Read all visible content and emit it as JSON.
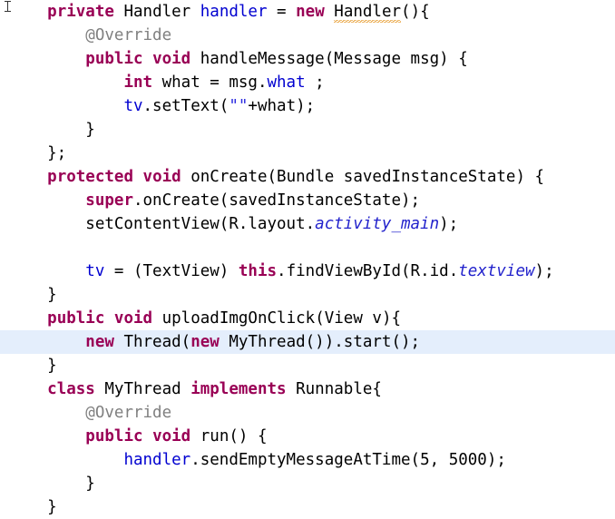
{
  "editor": {
    "language": "java",
    "background_color": "#ffffff",
    "highlight_color": "#e4eefc",
    "keyword_color": "#990055",
    "field_color": "#0000d0",
    "annotation_color": "#808080",
    "string_color": "#2a2ae0",
    "warning_squiggle_color": "#e8a33d",
    "cursor": "text-ibeam-cursor",
    "line_count": 20
  },
  "lines": [
    {
      "index": 0,
      "highlighted": false,
      "text": "    private Handler handler = new Handler(){",
      "tokens": [
        {
          "t": "    ",
          "c": "plain"
        },
        {
          "t": "private",
          "c": "kw"
        },
        {
          "t": " Handler ",
          "c": "plain"
        },
        {
          "t": "handler",
          "c": "field"
        },
        {
          "t": " = ",
          "c": "plain"
        },
        {
          "t": "new",
          "c": "kw"
        },
        {
          "t": " ",
          "c": "plain"
        },
        {
          "t": "Handler",
          "c": "warn"
        },
        {
          "t": "(){",
          "c": "plain"
        }
      ]
    },
    {
      "index": 1,
      "highlighted": false,
      "text": "        @Override",
      "tokens": [
        {
          "t": "        ",
          "c": "plain"
        },
        {
          "t": "@Override",
          "c": "anno"
        }
      ]
    },
    {
      "index": 2,
      "highlighted": false,
      "text": "        public void handleMessage(Message msg) {",
      "tokens": [
        {
          "t": "        ",
          "c": "plain"
        },
        {
          "t": "public",
          "c": "kw"
        },
        {
          "t": " ",
          "c": "plain"
        },
        {
          "t": "void",
          "c": "kw"
        },
        {
          "t": " handleMessage(Message msg) {",
          "c": "plain"
        }
      ]
    },
    {
      "index": 3,
      "highlighted": false,
      "text": "            int what = msg.what ;",
      "tokens": [
        {
          "t": "            ",
          "c": "plain"
        },
        {
          "t": "int",
          "c": "kw"
        },
        {
          "t": " what = msg.",
          "c": "plain"
        },
        {
          "t": "what",
          "c": "field"
        },
        {
          "t": " ;",
          "c": "plain"
        }
      ]
    },
    {
      "index": 4,
      "highlighted": false,
      "text": "            tv.setText(\"\"+what);",
      "tokens": [
        {
          "t": "            ",
          "c": "plain"
        },
        {
          "t": "tv",
          "c": "field"
        },
        {
          "t": ".setText(",
          "c": "plain"
        },
        {
          "t": "\"\"",
          "c": "str"
        },
        {
          "t": "+what);",
          "c": "plain"
        }
      ]
    },
    {
      "index": 5,
      "highlighted": false,
      "text": "        }",
      "tokens": [
        {
          "t": "        }",
          "c": "plain"
        }
      ]
    },
    {
      "index": 6,
      "highlighted": false,
      "text": "    };",
      "tokens": [
        {
          "t": "    };",
          "c": "plain"
        }
      ]
    },
    {
      "index": 7,
      "highlighted": false,
      "text": "    protected void onCreate(Bundle savedInstanceState) {",
      "tokens": [
        {
          "t": "    ",
          "c": "plain"
        },
        {
          "t": "protected",
          "c": "kw"
        },
        {
          "t": " ",
          "c": "plain"
        },
        {
          "t": "void",
          "c": "kw"
        },
        {
          "t": " onCreate(Bundle savedInstanceState) {",
          "c": "plain"
        }
      ]
    },
    {
      "index": 8,
      "highlighted": false,
      "text": "        super.onCreate(savedInstanceState);",
      "tokens": [
        {
          "t": "        ",
          "c": "plain"
        },
        {
          "t": "super",
          "c": "kw"
        },
        {
          "t": ".onCreate(savedInstanceState);",
          "c": "plain"
        }
      ]
    },
    {
      "index": 9,
      "highlighted": false,
      "text": "        setContentView(R.layout.activity_main);",
      "tokens": [
        {
          "t": "        setContentView(R.layout.",
          "c": "plain"
        },
        {
          "t": "activity_main",
          "c": "field-i"
        },
        {
          "t": ");",
          "c": "plain"
        }
      ]
    },
    {
      "index": 10,
      "highlighted": false,
      "text": "",
      "tokens": []
    },
    {
      "index": 11,
      "highlighted": false,
      "text": "        tv = (TextView) this.findViewById(R.id.textview);",
      "tokens": [
        {
          "t": "        ",
          "c": "plain"
        },
        {
          "t": "tv",
          "c": "field"
        },
        {
          "t": " = (TextView) ",
          "c": "plain"
        },
        {
          "t": "this",
          "c": "kw"
        },
        {
          "t": ".findViewById(R.id.",
          "c": "plain"
        },
        {
          "t": "textview",
          "c": "field-i"
        },
        {
          "t": ");",
          "c": "plain"
        }
      ]
    },
    {
      "index": 12,
      "highlighted": false,
      "text": "    }",
      "tokens": [
        {
          "t": "    }",
          "c": "plain"
        }
      ]
    },
    {
      "index": 13,
      "highlighted": false,
      "text": "    public void uploadImgOnClick(View v){",
      "tokens": [
        {
          "t": "    ",
          "c": "plain"
        },
        {
          "t": "public",
          "c": "kw"
        },
        {
          "t": " ",
          "c": "plain"
        },
        {
          "t": "void",
          "c": "kw"
        },
        {
          "t": " uploadImgOnClick(View v){",
          "c": "plain"
        }
      ]
    },
    {
      "index": 14,
      "highlighted": true,
      "text": "        new Thread(new MyThread()).start();",
      "tokens": [
        {
          "t": "        ",
          "c": "plain"
        },
        {
          "t": "new",
          "c": "kw"
        },
        {
          "t": " Thread(",
          "c": "plain"
        },
        {
          "t": "new",
          "c": "kw"
        },
        {
          "t": " MyThread()).start();",
          "c": "plain"
        }
      ]
    },
    {
      "index": 15,
      "highlighted": false,
      "text": "    }",
      "tokens": [
        {
          "t": "    }",
          "c": "plain"
        }
      ]
    },
    {
      "index": 16,
      "highlighted": false,
      "text": "    class MyThread implements Runnable{",
      "tokens": [
        {
          "t": "    ",
          "c": "plain"
        },
        {
          "t": "class",
          "c": "kw"
        },
        {
          "t": " MyThread ",
          "c": "plain"
        },
        {
          "t": "implements",
          "c": "kw"
        },
        {
          "t": " Runnable{",
          "c": "plain"
        }
      ]
    },
    {
      "index": 17,
      "highlighted": false,
      "text": "        @Override",
      "tokens": [
        {
          "t": "        ",
          "c": "plain"
        },
        {
          "t": "@Override",
          "c": "anno"
        }
      ]
    },
    {
      "index": 18,
      "highlighted": false,
      "text": "        public void run() {",
      "tokens": [
        {
          "t": "        ",
          "c": "plain"
        },
        {
          "t": "public",
          "c": "kw"
        },
        {
          "t": " ",
          "c": "plain"
        },
        {
          "t": "void",
          "c": "kw"
        },
        {
          "t": " run() {",
          "c": "plain"
        }
      ]
    },
    {
      "index": 19,
      "highlighted": false,
      "text": "            handler.sendEmptyMessageAtTime(5, 5000);",
      "tokens": [
        {
          "t": "            ",
          "c": "plain"
        },
        {
          "t": "handler",
          "c": "field"
        },
        {
          "t": ".sendEmptyMessageAtTime(",
          "c": "plain"
        },
        {
          "t": "5",
          "c": "num"
        },
        {
          "t": ", ",
          "c": "plain"
        },
        {
          "t": "5000",
          "c": "num"
        },
        {
          "t": ");",
          "c": "plain"
        }
      ]
    },
    {
      "index": 20,
      "highlighted": false,
      "text": "        }",
      "tokens": [
        {
          "t": "        }",
          "c": "plain"
        }
      ]
    },
    {
      "index": 21,
      "highlighted": false,
      "text": "    }",
      "tokens": [
        {
          "t": "    }",
          "c": "plain"
        }
      ]
    }
  ]
}
